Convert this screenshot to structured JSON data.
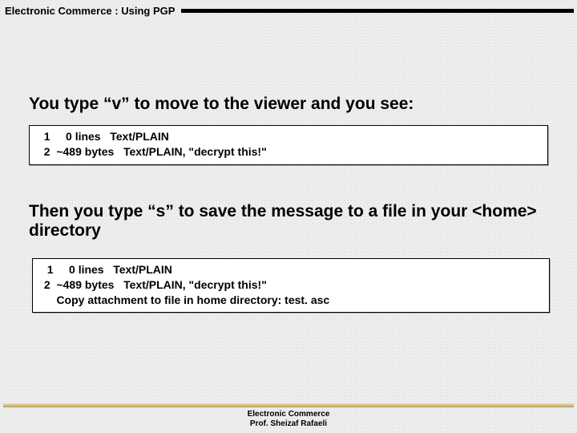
{
  "title": "Electronic Commerce :  Using PGP",
  "heading1": "You type “v” to move to the viewer and you see:",
  "box1": {
    "line1": "  1     0 lines   Text/PLAIN",
    "line2": "  2  ~489 bytes   Text/PLAIN, \"decrypt this!\""
  },
  "heading2": "Then you type “s” to save the message to a file in your <home> directory",
  "box2": {
    "line1": "  1     0 lines   Text/PLAIN",
    "line2": " 2  ~489 bytes   Text/PLAIN, \"decrypt this!\"",
    "line3": "     Copy attachment to file in home directory: test. asc"
  },
  "footer": {
    "line1": "Electronic Commerce",
    "line2": "Prof. Sheizaf Rafaeli"
  }
}
